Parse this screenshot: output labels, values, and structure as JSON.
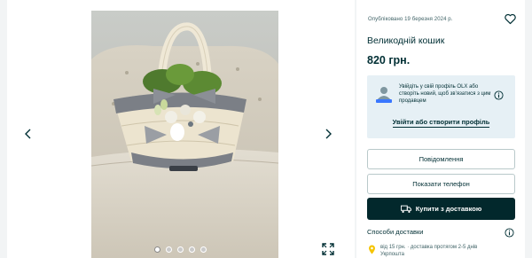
{
  "gallery": {
    "photo_alt": "",
    "dots_count": 5,
    "active_dot": 0
  },
  "listing": {
    "published": "Опубліковано 19 березня 2024 р.",
    "title": "Великодній кошик",
    "price": "820 грн."
  },
  "login_prompt": {
    "text": "Увійдіть у свій профіль OLX або створіть новий, щоб зв’язатися з цим продавцем",
    "link": "Увійти або створити профіль"
  },
  "actions": {
    "message": "Повідомлення",
    "phone": "Показати телефон",
    "buy": "Купити з доставкою"
  },
  "delivery": {
    "title": "Способи доставки",
    "line1": "від 15 грн. · доставка протягом 2-5 днів",
    "line2": "Укрпошта"
  },
  "colors": {
    "primary": "#002f34",
    "buy_button": "#02282c",
    "login_bg": "#e6f0f5",
    "pin": "#f5c400"
  }
}
